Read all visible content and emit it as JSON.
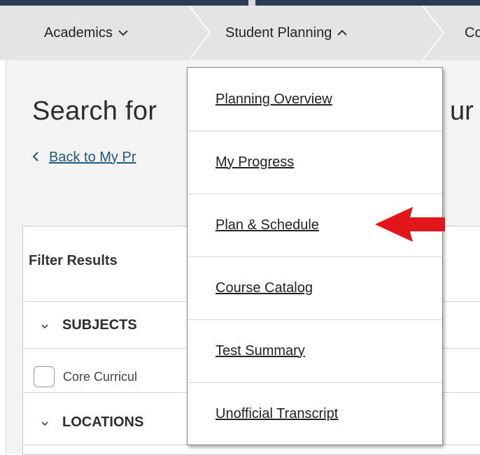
{
  "nav": {
    "items": [
      {
        "label": "Academics",
        "chevron": "chevron-down"
      },
      {
        "label": "Student Planning",
        "chevron": "chevron-up"
      },
      {
        "label": "Co"
      }
    ],
    "chevron_down_glyph": "⌄",
    "chevron_up_glyph": "^"
  },
  "page": {
    "title": "Search for",
    "title_tail": "ur",
    "back_link": "Back to My Pr",
    "back_glyph": "<"
  },
  "filter": {
    "header": "Filter Results",
    "sections": [
      {
        "label": "SUBJECTS"
      },
      {
        "label": "LOCATIONS"
      }
    ],
    "caret_glyph": "˅",
    "subject_option": "Core Curricul"
  },
  "menu": {
    "items": [
      "Planning Overview",
      "My Progress",
      "Plan & Schedule",
      "Course Catalog",
      "Test Summary",
      "Unofficial Transcript"
    ]
  },
  "colors": {
    "nav_bg": "#e4e4e4",
    "link": "#1f5a7a",
    "arrow": "#e3161b",
    "top_strip": "#2b3a55"
  }
}
